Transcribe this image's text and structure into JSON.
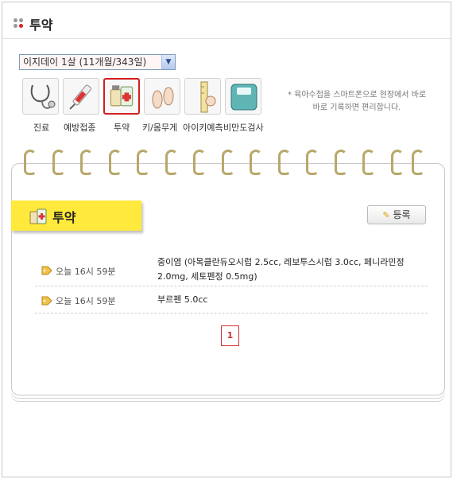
{
  "header": {
    "title": "투약"
  },
  "child_select": {
    "selected": "이지데이 1살 (11개월/343일)"
  },
  "menu": [
    {
      "label": "진료",
      "icon": "stethoscope-icon"
    },
    {
      "label": "예방접종",
      "icon": "syringe-icon"
    },
    {
      "label": "투약",
      "icon": "medicine-icon",
      "active": true
    },
    {
      "label": "키/몸무게",
      "icon": "footprint-icon"
    },
    {
      "label": "아이키예측",
      "icon": "height-chart-icon"
    },
    {
      "label": "비만도검사",
      "icon": "scale-icon"
    }
  ],
  "note": "* 육아수첩을 스마트폰으로 현장에서 바로 바로 기록하면 편리합니다.",
  "section": {
    "title": "투약",
    "register_label": "등록"
  },
  "records": [
    {
      "time": "오늘 16시 59분",
      "detail": "중이염 (아목클란듀오시럽 2.5cc, 레보투스시럽 3.0cc, 페니라민정 2.0mg, 세토펜정 0.5mg)"
    },
    {
      "time": "오늘 16시 59분",
      "detail": "부르펜 5.0cc"
    }
  ],
  "pagination": {
    "current": "1"
  }
}
